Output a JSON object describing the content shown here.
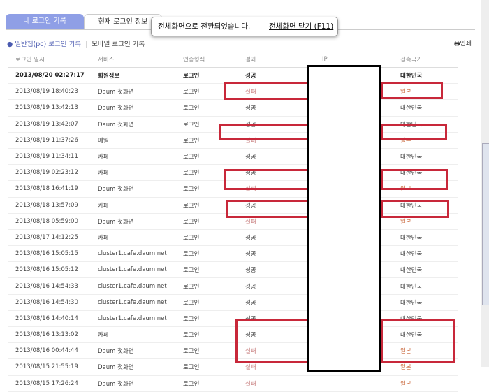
{
  "tabs": [
    "내 로그인 기록",
    "현재 로그인 정보"
  ],
  "toast": {
    "message": "전체화면으로 전환되었습니다.",
    "close_link": "전체화면 닫기 (F11)"
  },
  "subtabs": {
    "pc": "일반웹(pc) 로그인 기록",
    "mobile": "모바일 로그인 기록"
  },
  "print": "인쇄",
  "columns": [
    "로그인 일시",
    "서비스",
    "인증형식",
    "결과",
    "IP",
    "접속국가"
  ],
  "rows": [
    [
      "2013/08/20 02:27:17",
      "회원정보",
      "로그인",
      "성공",
      "",
      "대한민국"
    ],
    [
      "2013/08/19 18:40:23",
      "Daum 첫화면",
      "로그인",
      "실패",
      "",
      "일본"
    ],
    [
      "2013/08/19 13:42:13",
      "Daum 첫화면",
      "로그인",
      "성공",
      "",
      "대한민국"
    ],
    [
      "2013/08/19 13:42:07",
      "Daum 첫화면",
      "로그인",
      "성공",
      "",
      "대한민국"
    ],
    [
      "2013/08/19 11:37:26",
      "메일",
      "로그인",
      "실패",
      "",
      "일본"
    ],
    [
      "2013/08/19 11:34:11",
      "카페",
      "로그인",
      "성공",
      "",
      "대한민국"
    ],
    [
      "2013/08/19 02:23:12",
      "카페",
      "로그인",
      "성공",
      "",
      "대한민국"
    ],
    [
      "2013/08/18 16:41:19",
      "Daum 첫화면",
      "로그인",
      "실패",
      "",
      "일본"
    ],
    [
      "2013/08/18 13:57:09",
      "카페",
      "로그인",
      "성공",
      "",
      "대한민국"
    ],
    [
      "2013/08/18 05:59:00",
      "Daum 첫화면",
      "로그인",
      "실패",
      "",
      "일본"
    ],
    [
      "2013/08/17 14:12:25",
      "카페",
      "로그인",
      "성공",
      "",
      "대한민국"
    ],
    [
      "2013/08/16 15:05:15",
      "cluster1.cafe.daum.net",
      "로그인",
      "성공",
      "",
      "대한민국"
    ],
    [
      "2013/08/16 15:05:12",
      "cluster1.cafe.daum.net",
      "로그인",
      "성공",
      "",
      "대한민국"
    ],
    [
      "2013/08/16 14:54:33",
      "cluster1.cafe.daum.net",
      "로그인",
      "성공",
      "",
      "대한민국"
    ],
    [
      "2013/08/16 14:54:30",
      "cluster1.cafe.daum.net",
      "로그인",
      "성공",
      "",
      "대한민국"
    ],
    [
      "2013/08/16 14:40:14",
      "cluster1.cafe.daum.net",
      "로그인",
      "성공",
      "",
      "대한민국"
    ],
    [
      "2013/08/16 13:13:02",
      "카페",
      "로그인",
      "성공",
      "",
      "대한민국"
    ],
    [
      "2013/08/16 00:44:44",
      "Daum 첫화면",
      "로그인",
      "실패",
      "",
      "일본"
    ],
    [
      "2013/08/15 21:55:19",
      "Daum 첫화면",
      "로그인",
      "실패",
      "",
      "일본"
    ],
    [
      "2013/08/15 17:26:24",
      "Daum 첫화면",
      "로그인",
      "실패",
      "",
      "일본"
    ]
  ],
  "colors": {
    "accent": "#8f9fe6",
    "highlight": "#c8283a"
  }
}
